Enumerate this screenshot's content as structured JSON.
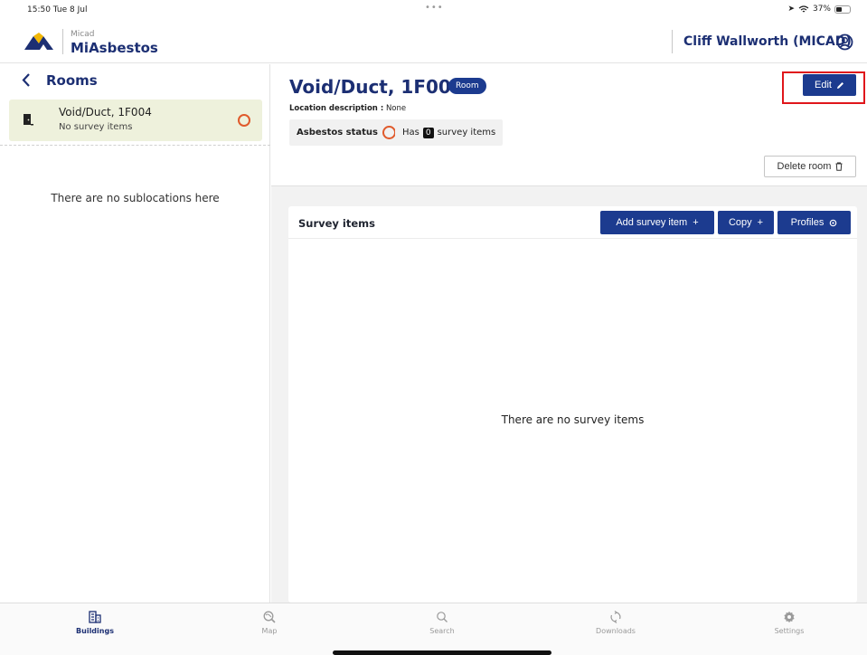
{
  "status_bar": {
    "time": "15:50  Tue 8 Jul",
    "dots": "•••",
    "battery": "37%"
  },
  "header": {
    "brand_small": "Micad",
    "brand_name": "MiAsbestos",
    "user_name": "Cliff Wallworth (MICAD)"
  },
  "left_panel": {
    "title": "Rooms",
    "room": {
      "name": "Void/Duct, 1F004",
      "subtitle": "No survey items",
      "status_color": "#e05a2b"
    },
    "empty_text": "There are no sublocations here"
  },
  "detail": {
    "title": "Void/Duct, 1F004",
    "badge": "Room",
    "location_label": "Location description :",
    "location_value": "None",
    "asbestos_label": "Asbestos status",
    "has_label": "Has",
    "survey_count": "0",
    "survey_suffix": "survey items",
    "edit_label": "Edit",
    "delete_label": "Delete room"
  },
  "survey": {
    "title": "Survey items",
    "add_label": "Add survey item",
    "copy_label": "Copy",
    "profiles_label": "Profiles",
    "empty_text": "There are no survey items"
  },
  "nav": [
    {
      "label": "Buildings",
      "icon": "buildings-icon",
      "active": true
    },
    {
      "label": "Map",
      "icon": "map-icon",
      "active": false
    },
    {
      "label": "Search",
      "icon": "search-icon",
      "active": false
    },
    {
      "label": "Downloads",
      "icon": "sync-icon",
      "active": false
    },
    {
      "label": "Settings",
      "icon": "gear-icon",
      "active": false
    }
  ],
  "colors": {
    "brand_navy": "#1c2f73",
    "button_blue": "#1c3b8f",
    "highlight_red": "#e0161b",
    "room_card_bg": "#eef1dc"
  }
}
